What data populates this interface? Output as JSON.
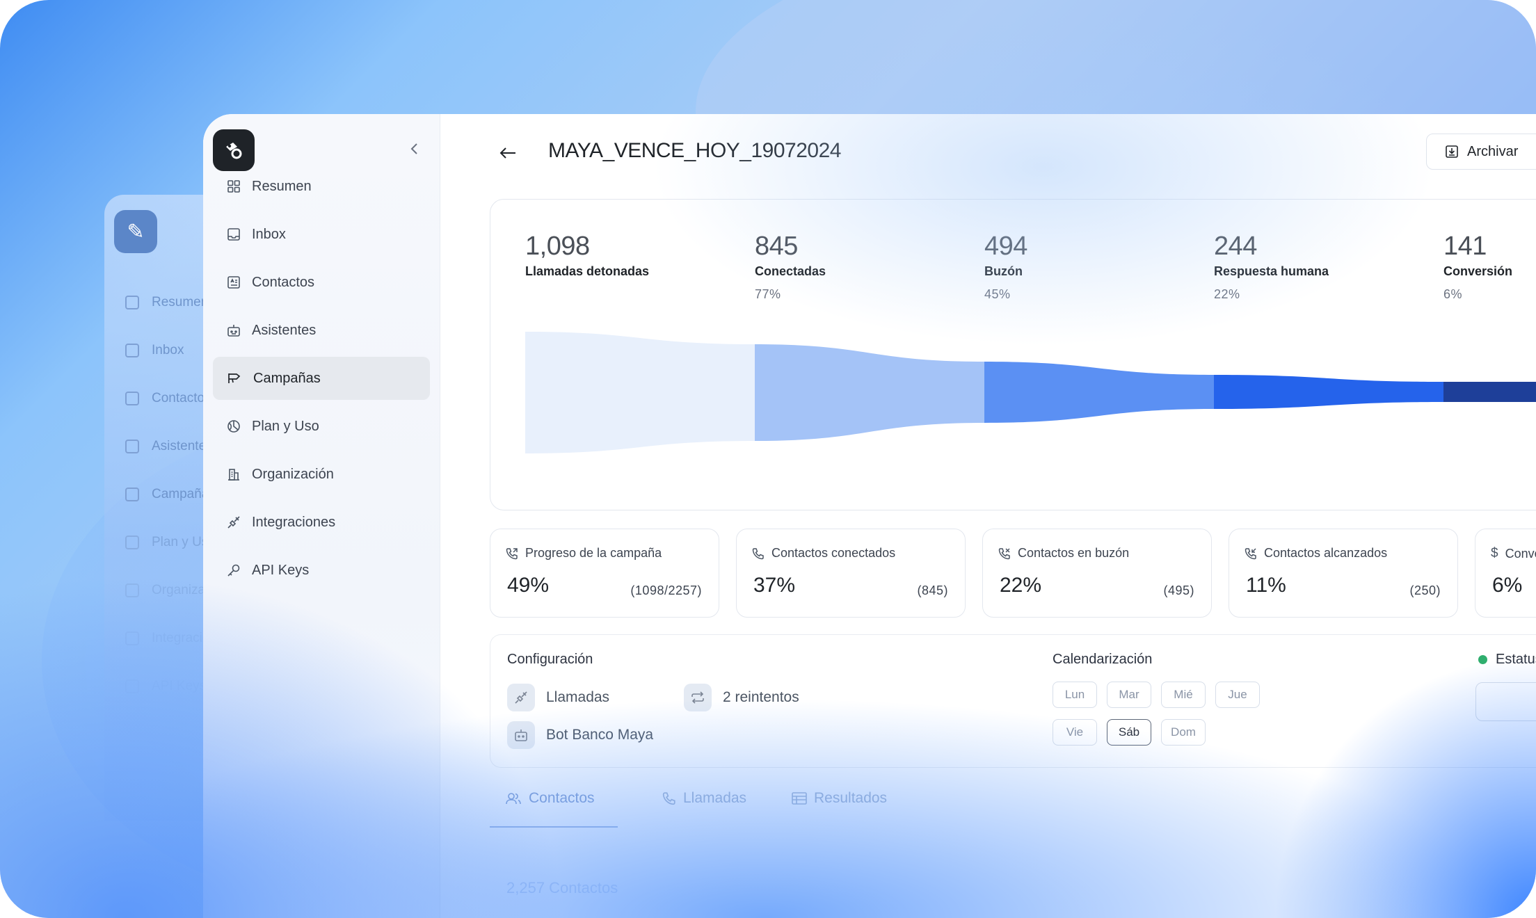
{
  "ghost_sidebar": {
    "items": [
      "Resumen",
      "Inbox",
      "Contactos",
      "Asistentes",
      "Campañas",
      "Plan y Uso",
      "Organización",
      "Integraciones",
      "API Keys"
    ]
  },
  "sidebar": {
    "items": [
      {
        "label": "Resumen",
        "icon": "grid-icon"
      },
      {
        "label": "Inbox",
        "icon": "inbox-icon"
      },
      {
        "label": "Contactos",
        "icon": "contact-card-icon"
      },
      {
        "label": "Asistentes",
        "icon": "robot-icon"
      },
      {
        "label": "Campañas",
        "icon": "megaphone-icon",
        "active": true
      },
      {
        "label": "Plan y Uso",
        "icon": "chart-pie-icon"
      },
      {
        "label": "Organización",
        "icon": "building-icon"
      },
      {
        "label": "Integraciones",
        "icon": "plug-icon"
      },
      {
        "label": "API Keys",
        "icon": "key-icon"
      }
    ]
  },
  "header": {
    "title": "MAYA_VENCE_HOY_19072024",
    "archive_label": "Archivar"
  },
  "funnel": {
    "stages": [
      {
        "value": "1,098",
        "label": "Llamadas detonadas",
        "pct": ""
      },
      {
        "value": "845",
        "label": "Conectadas",
        "pct": "77%"
      },
      {
        "value": "494",
        "label": "Buzón",
        "pct": "45%"
      },
      {
        "value": "244",
        "label": "Respuesta humana",
        "pct": "22%"
      },
      {
        "value": "141",
        "label": "Conversión",
        "pct": "6%"
      }
    ],
    "colors": [
      "#e8f0fc",
      "#a4c3f7",
      "#5b90f3",
      "#2563eb",
      "#1e3f99"
    ]
  },
  "kpis": [
    {
      "title": "Progreso de la campaña",
      "value": "49%",
      "count": "(1098/2257)",
      "icon": "phone-outgoing-icon"
    },
    {
      "title": "Contactos conectados",
      "value": "37%",
      "count": "(845)",
      "icon": "phone-icon"
    },
    {
      "title": "Contactos en buzón",
      "value": "22%",
      "count": "(495)",
      "icon": "phone-voicemail-icon"
    },
    {
      "title": "Contactos alcanzados",
      "value": "11%",
      "count": "(250)",
      "icon": "phone-incoming-icon"
    },
    {
      "title": "Conversión",
      "value": "6%",
      "count": "",
      "icon": "dollar-icon"
    }
  ],
  "config": {
    "title": "Configuración",
    "channel": "Llamadas",
    "retries": "2 reintentos",
    "bot": "Bot Banco Maya"
  },
  "schedule": {
    "title": "Calendarización",
    "days": [
      {
        "label": "Lun",
        "selected": false
      },
      {
        "label": "Mar",
        "selected": false
      },
      {
        "label": "Mié",
        "selected": false
      },
      {
        "label": "Jue",
        "selected": false
      },
      {
        "label": "Vie",
        "selected": false
      },
      {
        "label": "Sáb",
        "selected": true
      },
      {
        "label": "Dom",
        "selected": false
      }
    ]
  },
  "status": {
    "label": "Estatus",
    "color": "#2fae6e"
  },
  "tabs": [
    {
      "label": "Contactos",
      "icon": "users-icon",
      "active": true
    },
    {
      "label": "Llamadas",
      "icon": "phone-icon"
    },
    {
      "label": "Resultados",
      "icon": "table-icon"
    }
  ],
  "footer": {
    "count_label": "2,257 Contactos"
  }
}
